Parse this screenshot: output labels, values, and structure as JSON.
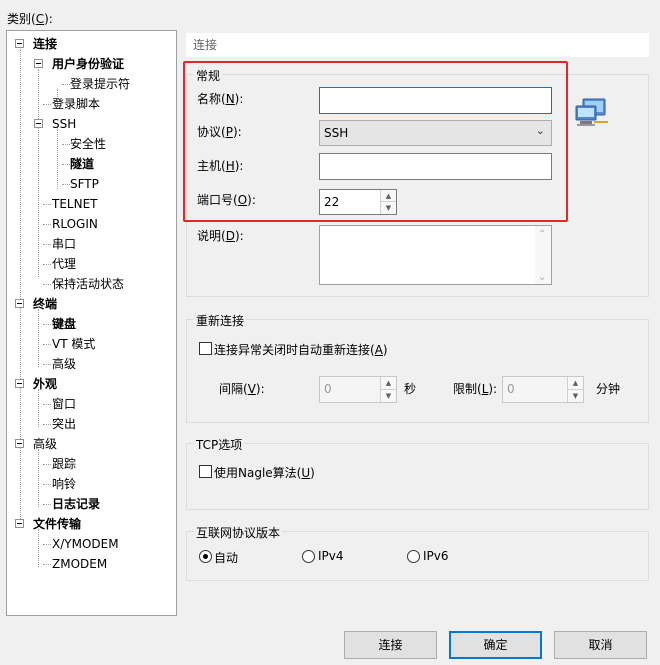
{
  "category_label": "类别(C):",
  "category_label_pre": "类别(",
  "category_label_key": "C",
  "category_label_post": "):",
  "tree": {
    "connection": "连接",
    "user_auth": "用户身份验证",
    "login_prompts": "登录提示符",
    "login_scripts": "登录脚本",
    "ssh": "SSH",
    "security": "安全性",
    "tunneling": "隧道",
    "sftp": "SFTP",
    "telnet": "TELNET",
    "rlogin": "RLOGIN",
    "serial": "串口",
    "proxy": "代理",
    "keep_alive": "保持活动状态",
    "terminal": "终端",
    "keyboard": "键盘",
    "vt_modes": "VT 模式",
    "advanced_terminal": "高级",
    "appearance": "外观",
    "window": "窗口",
    "highlight": "突出",
    "advanced": "高级",
    "trace": "跟踪",
    "bell": "响铃",
    "logging": "日志记录",
    "file_transfer": "文件传输",
    "xymodem": "X/YMODEM",
    "zmodem": "ZMODEM"
  },
  "panel": {
    "title": "连接",
    "general_group": "常规",
    "name_label_pre": "名称(",
    "name_label_key": "N",
    "name_label_post": "):",
    "name_value": "",
    "protocol_label_pre": "协议(",
    "protocol_label_key": "P",
    "protocol_label_post": "):",
    "protocol_value": "SSH",
    "host_label_pre": "主机(",
    "host_label_key": "H",
    "host_label_post": "):",
    "host_value": "",
    "port_label_pre": "端口号(",
    "port_label_key": "O",
    "port_label_post": "):",
    "port_value": "22",
    "desc_label_pre": "说明(",
    "desc_label_key": "D",
    "desc_label_post": "):",
    "reconnect_group": "重新连接",
    "reconnect_check_pre": "连接异常关闭时自动重新连接(",
    "reconnect_check_key": "A",
    "reconnect_check_post": ")",
    "interval_label_pre": "间隔(",
    "interval_label_key": "V",
    "interval_label_post": "):",
    "interval_value": "0",
    "interval_unit": "秒",
    "limit_label_pre": "限制(",
    "limit_label_key": "L",
    "limit_label_post": "):",
    "limit_value": "0",
    "limit_unit": "分钟",
    "tcp_group": "TCP选项",
    "nagle_pre": "使用Nagle算法(",
    "nagle_key": "U",
    "nagle_post": ")",
    "ip_group": "互联网协议版本",
    "ip_auto": "自动",
    "ip_v4": "IPv4",
    "ip_v6": "IPv6"
  },
  "buttons": {
    "connect": "连接",
    "ok": "确定",
    "cancel": "取消"
  },
  "colors": {
    "highlight_border": "#e8262a",
    "focus_border": "#0078d7"
  }
}
